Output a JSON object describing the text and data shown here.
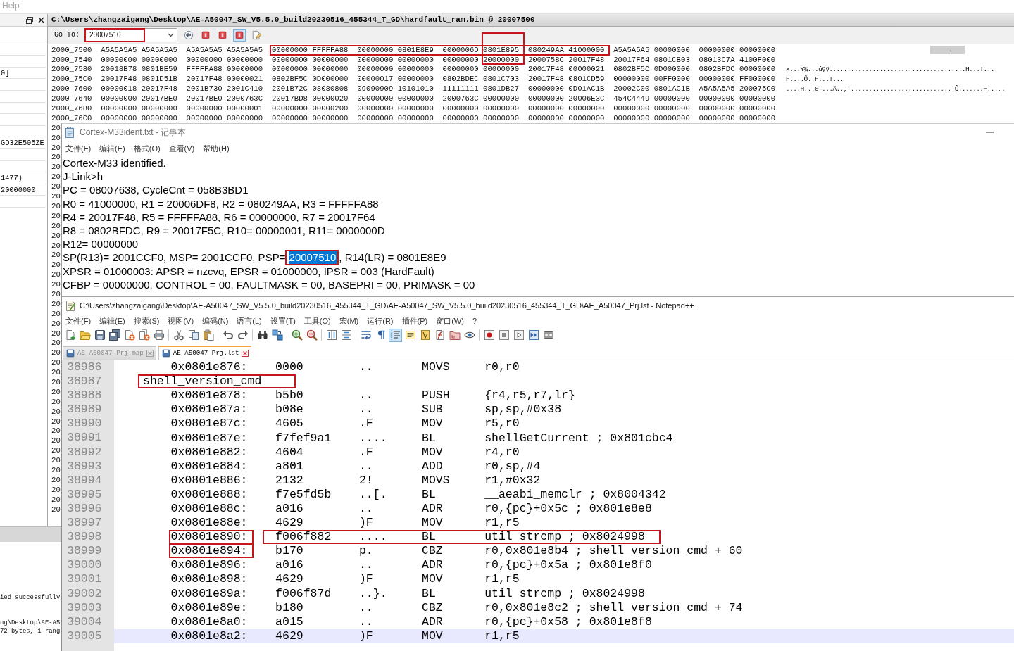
{
  "app_menu": {
    "label": "Help"
  },
  "side_panel": {
    "rows": [
      {},
      {},
      {},
      {
        "text": "0]"
      },
      {},
      {},
      {},
      {},
      {},
      {
        "text": "GD32E505ZE"
      },
      {},
      {},
      {
        "text": "1477)"
      },
      {
        "text": "20000000"
      },
      {}
    ]
  },
  "output_panel": {
    "groups": [
      [
        "ied successfully"
      ],
      [
        "ng\\Desktop\\AE-A5",
        "72 bytes, 1 rang"
      ]
    ]
  },
  "memory_window": {
    "title": "C:\\Users\\zhangzaigang\\Desktop\\AE-A50047_SW_V5.5.0_build20230516_455344_T_GD\\hardfault_ram.bin @ 20007500",
    "go_to": {
      "label": "Go To:",
      "value": "20007510",
      "framed": true
    },
    "tools": [
      {
        "kind": "back",
        "pressed": false
      },
      {
        "kind": "bookmark",
        "pressed": false
      },
      {
        "kind": "bookmark",
        "pressed": false
      },
      {
        "kind": "bookmark",
        "pressed": true
      },
      {
        "kind": "edit",
        "pressed": false
      }
    ],
    "rows": [
      {
        "address": "2000_7500",
        "words": [
          "A5A5A5A5",
          "A5A5A5A5",
          "A5A5A5A5",
          "A5A5A5A5",
          "00000000",
          "FFFFFA88",
          "00000000",
          "0801E8E9",
          "0000006D",
          "0801E895",
          "080249AA",
          "41000000",
          "A5A5A5A5",
          "00000000",
          "00000000",
          "00000000"
        ],
        "ascii": ".",
        "ascii_selected": true
      },
      {
        "address": "2000_7540",
        "words": [
          "00000000",
          "00000000",
          "00000000",
          "00000000",
          "00000000",
          "00000000",
          "00000000",
          "00000000",
          "00000000",
          "20000000",
          "2000758C",
          "20017F48",
          "20017F64",
          "0801CB03",
          "08013C7A",
          "4100F000"
        ],
        "ascii_selected": false
      },
      {
        "address": "2000_7580",
        "words": [
          "20018B78",
          "0801BE59",
          "FFFFFA88",
          "00000000",
          "00000000",
          "00000000",
          "00000000",
          "00000000",
          "00000000",
          "00000000",
          "20017F48",
          "00000021",
          "0802BF5C",
          "0D000000",
          "0802BFDC",
          "00000000"
        ],
        "ascii": "x...Y¾...úÿÿ......................................H...!...",
        "ascii_selected": false
      },
      {
        "address": "2000_75C0",
        "words": [
          "20017F48",
          "0801D51B",
          "20017F48",
          "00000021",
          "0802BF5C",
          "0D000000",
          "00000017",
          "00000000",
          "0802BDEC",
          "0801C703",
          "20017F48",
          "0801CD59",
          "00000000",
          "00FF0000",
          "00000000",
          "FF000000"
        ],
        "ascii": "H....Õ..H...!...",
        "ascii_selected": false
      },
      {
        "address": "2000_7600",
        "words": [
          "00000018",
          "20017F48",
          "2001B730",
          "2001C410",
          "2001B72C",
          "08080808",
          "09090909",
          "10101010",
          "11111111",
          "0801DB27",
          "00000000",
          "0D01AC1B",
          "20002C00",
          "0801AC1B",
          "A5A5A5A5",
          "200075C0"
        ],
        "ascii": "....H...0·...Ä..,·............................'Û.......¬...,.",
        "ascii_selected": false
      },
      {
        "address": "2000_7640",
        "words": [
          "00000000",
          "20017BE0",
          "20017BE0",
          "2000763C",
          "20017BD8",
          "00000020",
          "00000000",
          "00000000",
          "2000763C",
          "00000000",
          "00000000",
          "20006E3C",
          "454C4449",
          "00000000",
          "00000000",
          "00000000"
        ],
        "ascii_selected": false
      },
      {
        "address": "2000_7680",
        "words": [
          "00000000",
          "00000000",
          "00000000",
          "00000001",
          "00000000",
          "00000200",
          "00000000",
          "00000000",
          "00000000",
          "00000000",
          "00000000",
          "00000000",
          "00000000",
          "00000000",
          "00000000",
          "00000000"
        ],
        "ascii_selected": false
      },
      {
        "address": "2000_76C0",
        "words": [
          "00000000",
          "00000000",
          "00000000",
          "00000000",
          "00000000",
          "00000000",
          "00000000",
          "00000000",
          "00000000",
          "00000000",
          "00000000",
          "00000000",
          "00000000",
          "00000000",
          "00000000",
          "00000000"
        ],
        "ascii_selected": false
      }
    ],
    "covered_rows": [
      "20",
      "20",
      "20",
      "20",
      "20",
      "20",
      "20",
      "20",
      "20",
      "20",
      "20",
      "20",
      "20",
      "20",
      "20",
      "20",
      "20",
      "20",
      "20",
      "20",
      "20",
      "20",
      "20",
      "20",
      "20",
      "20",
      "20",
      "20",
      "20",
      "20",
      "20",
      "20",
      "20",
      "20",
      "20",
      "20",
      "20",
      "20",
      "20",
      "20"
    ],
    "row_span_framed": true,
    "column_framed": true
  },
  "notepad": {
    "title": "Cortex-M33ident.txt - 记事本",
    "menu": [
      "文件(F)",
      "编辑(E)",
      "格式(O)",
      "查看(V)",
      "帮助(H)"
    ],
    "lines": [
      {
        "text": "Cortex-M33 identified."
      },
      {
        "text": "J-Link>h"
      },
      {
        "text": "PC = 08007638, CycleCnt = 058B3BD1"
      },
      {
        "text": "R0 = 41000000, R1 = 20006DF8, R2 = 080249AA, R3 = FFFFFA88"
      },
      {
        "text": "R4 = 20017F48, R5 = FFFFFA88, R6 = 00000000, R7 = 20017F64"
      },
      {
        "text": "R8 = 0802BFDC, R9 = 20017F5C, R10= 00000001, R11= 0000000D"
      },
      {
        "text": "R12= 00000000"
      },
      {
        "text": "SP(R13)= 2001CCF0, MSP= 2001CCF0, PSP= ",
        "selection": {
          "text": "20007510",
          "selected": true,
          "framed": true
        },
        "text_after": ", R14(LR) = 0801E8E9"
      },
      {
        "text": "XPSR = 01000003: APSR = nzcvq, EPSR = 01000000, IPSR = 003 (HardFault)"
      },
      {
        "text": "CFBP = 00000000, CONTROL = 00, FAULTMASK = 00, BASEPRI = 00, PRIMASK = 00"
      }
    ]
  },
  "notepadpp": {
    "title": "C:\\Users\\zhangzaigang\\Desktop\\AE-A50047_SW_V5.5.0_build20230516_455344_T_GD\\AE-A50047_SW_V5.5.0_build20230516_455344_T_GD\\AE_A50047_Prj.lst - Notepad++",
    "menu": [
      "文件(F)",
      "编辑(E)",
      "搜索(S)",
      "视图(V)",
      "编码(N)",
      "语言(L)",
      "设置(T)",
      "工具(O)",
      "宏(M)",
      "运行(R)",
      "插件(P)",
      "窗口(W)",
      "?"
    ],
    "toolbar": [
      {
        "tools": [
          {
            "kind": "new",
            "pressed": false
          },
          {
            "kind": "open",
            "pressed": false
          },
          {
            "kind": "save",
            "pressed": false
          },
          {
            "kind": "save_all",
            "pressed": false
          },
          {
            "kind": "close",
            "pressed": false
          },
          {
            "kind": "close_all",
            "pressed": false
          },
          {
            "kind": "print",
            "pressed": false
          }
        ]
      },
      {
        "tools": [
          {
            "kind": "cut",
            "pressed": false
          },
          {
            "kind": "copy",
            "pressed": false
          },
          {
            "kind": "paste",
            "pressed": false
          }
        ]
      },
      {
        "tools": [
          {
            "kind": "undo",
            "pressed": false
          },
          {
            "kind": "redo",
            "pressed": false
          }
        ]
      },
      {
        "tools": [
          {
            "kind": "find",
            "pressed": false
          },
          {
            "kind": "replace",
            "pressed": false
          }
        ]
      },
      {
        "tools": [
          {
            "kind": "zoom_in",
            "pressed": false
          },
          {
            "kind": "zoom_out",
            "pressed": false
          }
        ]
      },
      {
        "tools": [
          {
            "kind": "sync_vertical",
            "pressed": false
          },
          {
            "kind": "sync_horizontal",
            "pressed": false
          }
        ]
      },
      {
        "tools": [
          {
            "kind": "wrap",
            "pressed": false
          },
          {
            "kind": "all_chars",
            "pressed": false
          },
          {
            "kind": "indent_guide",
            "pressed": true
          },
          {
            "kind": "udl",
            "pressed": false
          },
          {
            "kind": "doc_map",
            "pressed": false
          },
          {
            "kind": "function_list",
            "pressed": false
          },
          {
            "kind": "folder_workspace",
            "pressed": false
          },
          {
            "kind": "monitor",
            "pressed": false
          }
        ]
      },
      {
        "tools": [
          {
            "kind": "record",
            "pressed": false
          },
          {
            "kind": "stop",
            "pressed": false
          },
          {
            "kind": "play",
            "pressed": false
          },
          {
            "kind": "play_multiple",
            "pressed": false
          },
          {
            "kind": "save_macro",
            "pressed": false
          }
        ]
      }
    ],
    "tabs": [
      {
        "label": "AE_A50047_Prj.map",
        "selected": false
      },
      {
        "label": "AE_A50047_Prj.lst",
        "selected": true
      }
    ],
    "lines": [
      {
        "number": "38986",
        "kind": "instruction",
        "address": "0x0801e876:",
        "code": "0000",
        "ascii": "..",
        "mnemonic": "MOVS",
        "operands": "r0,r0",
        "address_framed": false,
        "code_framed": false,
        "current": false
      },
      {
        "number": "38987",
        "kind": "label",
        "label": "shell_version_cmd",
        "framed": true,
        "current": false
      },
      {
        "number": "38988",
        "kind": "instruction",
        "address": "0x0801e878:",
        "code": "b5b0",
        "ascii": "..",
        "mnemonic": "PUSH",
        "operands": "{r4,r5,r7,lr}",
        "address_framed": false,
        "code_framed": false,
        "current": false
      },
      {
        "number": "38989",
        "kind": "instruction",
        "address": "0x0801e87a:",
        "code": "b08e",
        "ascii": "..",
        "mnemonic": "SUB",
        "operands": "sp,sp,#0x38",
        "address_framed": false,
        "code_framed": false,
        "current": false
      },
      {
        "number": "38990",
        "kind": "instruction",
        "address": "0x0801e87c:",
        "code": "4605",
        "ascii": ".F",
        "mnemonic": "MOV",
        "operands": "r5,r0",
        "address_framed": false,
        "code_framed": false,
        "current": false
      },
      {
        "number": "38991",
        "kind": "instruction",
        "address": "0x0801e87e:",
        "code": "f7fef9a1",
        "ascii": "....",
        "mnemonic": "BL",
        "operands": "shellGetCurrent ; 0x801cbc4",
        "address_framed": false,
        "code_framed": false,
        "current": false
      },
      {
        "number": "38992",
        "kind": "instruction",
        "address": "0x0801e882:",
        "code": "4604",
        "ascii": ".F",
        "mnemonic": "MOV",
        "operands": "r4,r0",
        "address_framed": false,
        "code_framed": false,
        "current": false
      },
      {
        "number": "38993",
        "kind": "instruction",
        "address": "0x0801e884:",
        "code": "a801",
        "ascii": "..",
        "mnemonic": "ADD",
        "operands": "r0,sp,#4",
        "address_framed": false,
        "code_framed": false,
        "current": false
      },
      {
        "number": "38994",
        "kind": "instruction",
        "address": "0x0801e886:",
        "code": "2132",
        "ascii": "2!",
        "mnemonic": "MOVS",
        "operands": "r1,#0x32",
        "address_framed": false,
        "code_framed": false,
        "current": false
      },
      {
        "number": "38995",
        "kind": "instruction",
        "address": "0x0801e888:",
        "code": "f7e5fd5b",
        "ascii": "..[.",
        "mnemonic": "BL",
        "operands": "__aeabi_memclr ; 0x8004342",
        "address_framed": false,
        "code_framed": false,
        "current": false
      },
      {
        "number": "38996",
        "kind": "instruction",
        "address": "0x0801e88c:",
        "code": "a016",
        "ascii": "..",
        "mnemonic": "ADR",
        "operands": "r0,{pc}+0x5c ; 0x801e8e8",
        "address_framed": false,
        "code_framed": false,
        "current": false
      },
      {
        "number": "38997",
        "kind": "instruction",
        "address": "0x0801e88e:",
        "code": "4629",
        "ascii": ")F",
        "mnemonic": "MOV",
        "operands": "r1,r5",
        "address_framed": false,
        "code_framed": false,
        "current": false
      },
      {
        "number": "38998",
        "kind": "instruction",
        "address": "0x0801e890:",
        "code": "f006f882",
        "ascii": "....",
        "mnemonic": "BL",
        "operands": "util_strcmp ; 0x8024998",
        "address_framed": true,
        "code_framed": true,
        "current": false
      },
      {
        "number": "38999",
        "kind": "instruction",
        "address": "0x0801e894:",
        "code": "b170",
        "ascii": "p.",
        "mnemonic": "CBZ",
        "operands": "r0,0x801e8b4 ; shell_version_cmd + 60",
        "address_framed": true,
        "code_framed": false,
        "current": false
      },
      {
        "number": "39000",
        "kind": "instruction",
        "address": "0x0801e896:",
        "code": "a016",
        "ascii": "..",
        "mnemonic": "ADR",
        "operands": "r0,{pc}+0x5a ; 0x801e8f0",
        "address_framed": false,
        "code_framed": false,
        "current": false
      },
      {
        "number": "39001",
        "kind": "instruction",
        "address": "0x0801e898:",
        "code": "4629",
        "ascii": ")F",
        "mnemonic": "MOV",
        "operands": "r1,r5",
        "address_framed": false,
        "code_framed": false,
        "current": false
      },
      {
        "number": "39002",
        "kind": "instruction",
        "address": "0x0801e89a:",
        "code": "f006f87d",
        "ascii": "..}.",
        "mnemonic": "BL",
        "operands": "util_strcmp ; 0x8024998",
        "address_framed": false,
        "code_framed": false,
        "current": false
      },
      {
        "number": "39003",
        "kind": "instruction",
        "address": "0x0801e89e:",
        "code": "b180",
        "ascii": "..",
        "mnemonic": "CBZ",
        "operands": "r0,0x801e8c2 ; shell_version_cmd + 74",
        "address_framed": false,
        "code_framed": false,
        "current": false
      },
      {
        "number": "39004",
        "kind": "instruction",
        "address": "0x0801e8a0:",
        "code": "a015",
        "ascii": "..",
        "mnemonic": "ADR",
        "operands": "r0,{pc}+0x58 ; 0x801e8f8",
        "address_framed": false,
        "code_framed": false,
        "current": false
      },
      {
        "number": "39005",
        "kind": "instruction",
        "address": "0x0801e8a2:",
        "code": "4629",
        "ascii": ")F",
        "mnemonic": "MOV",
        "operands": "r1,r5",
        "address_framed": false,
        "code_framed": false,
        "current": true
      }
    ]
  }
}
